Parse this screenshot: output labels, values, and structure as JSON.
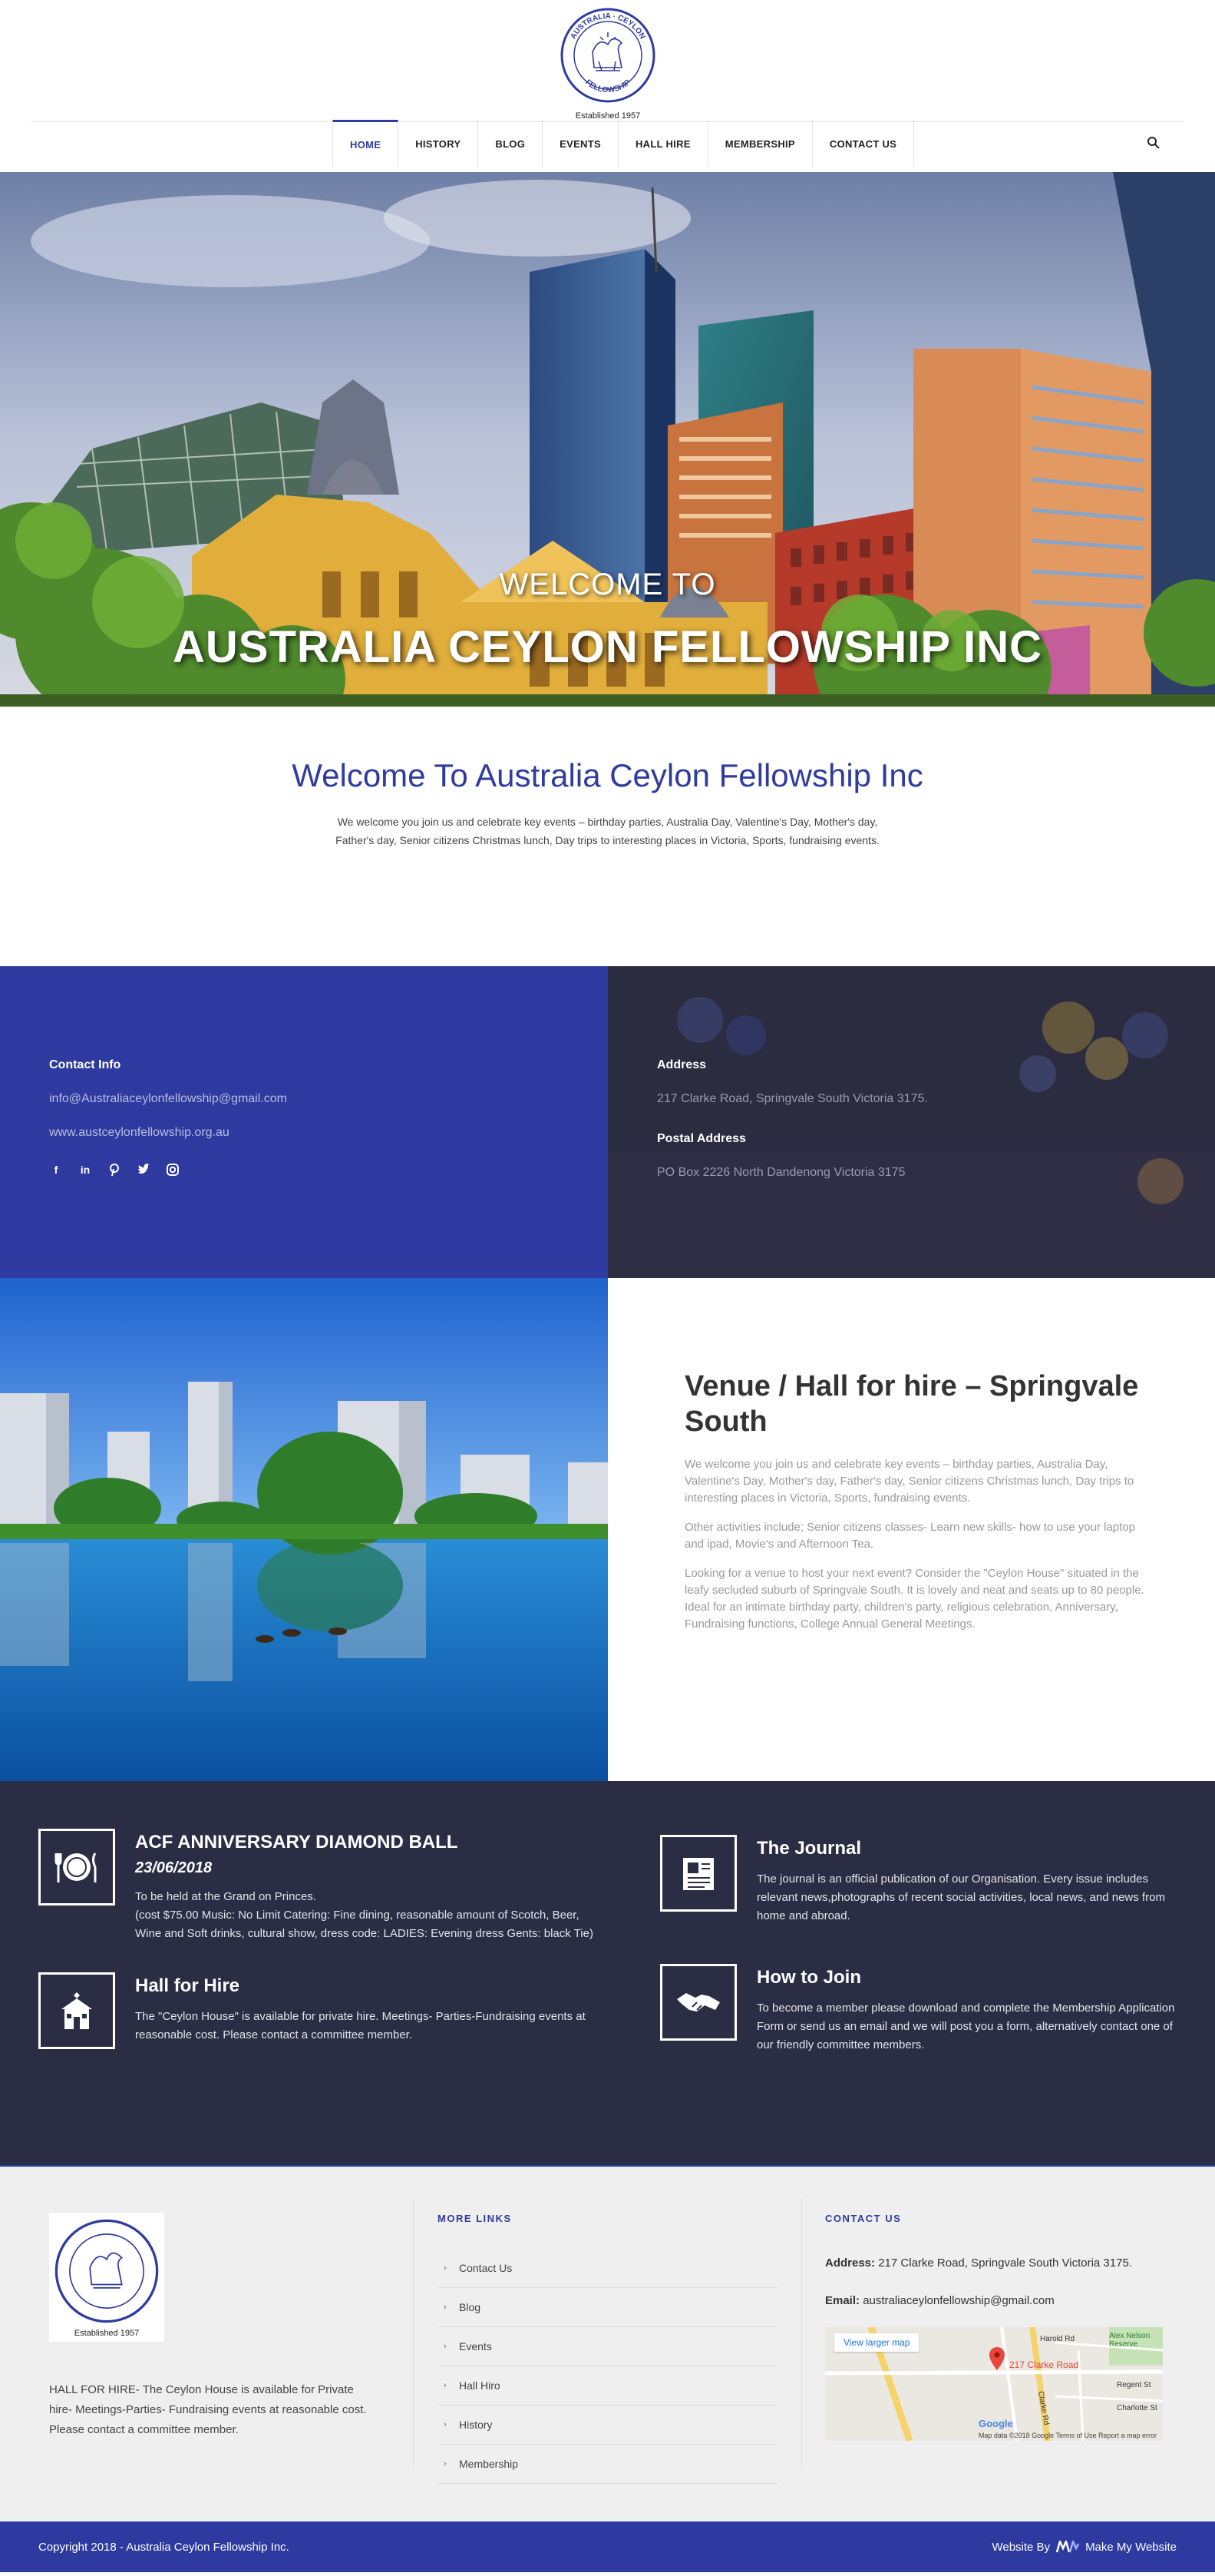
{
  "header": {
    "logo_ring_top": "AUSTRALIA · CEYLON",
    "logo_ring_bottom": "FELLOWSHIP",
    "logo_caption": "Established 1957",
    "nav": [
      {
        "label": "HOME",
        "active": true
      },
      {
        "label": "HISTORY"
      },
      {
        "label": "BLOG"
      },
      {
        "label": "EVENTS"
      },
      {
        "label": "HALL HIRE"
      },
      {
        "label": "MEMBERSHIP"
      },
      {
        "label": "CONTACT US"
      }
    ],
    "search_icon": "search-icon"
  },
  "hero": {
    "subtitle": "WELCOME TO",
    "title": "AUSTRALIA CEYLON FELLOWSHIP INC"
  },
  "welcome": {
    "heading": "Welcome To Australia Ceylon Fellowship Inc",
    "text": "We welcome you join us and celebrate key events – birthday parties, Australia Day, Valentine's Day, Mother's day, Father's day, Senior citizens Christmas lunch, Day trips to interesting places in Victoria, Sports, fundraising events."
  },
  "contact": {
    "info_heading": "Contact Info",
    "email": "info@Australiaceylonfellowship@gmail.com",
    "website": "www.austceylonfellowship.org.au",
    "socials": [
      "facebook-icon",
      "linkedin-icon",
      "pinterest-icon",
      "twitter-icon",
      "instagram-icon"
    ],
    "address_heading": "Address",
    "address": "217 Clarke Road, Springvale South Victoria 3175.",
    "postal_heading": "Postal Address",
    "postal": "PO Box 2226 North Dandenong Victoria 3175"
  },
  "venue": {
    "heading": "Venue / Hall for hire – Springvale South",
    "p1": "We welcome you join us and celebrate key events – birthday parties, Australia Day, Valentine's Day, Mother's day, Father's day, Senior citizens Christmas lunch, Day trips to interesting places in Victoria, Sports, fundraising events.",
    "p2": "Other activities include; Senior citizens classes- Learn new skills- how to use your laptop and ipad, Movie's and Afternoon Tea.",
    "p3": "Looking for a venue to host your next event? Consider the \"Ceylon House\" situated in the leafy secluded suburb of Springvale South. It is lovely and neat and seats up to 80 people. Ideal for an intimate birthday party, children's party, religious celebration, Anniversary, Fundraising functions, College Annual General Meetings."
  },
  "features": {
    "ball": {
      "title": "ACF ANNIVERSARY DIAMOND BALL",
      "date": "23/06/2018",
      "text": "To be held at the Grand on Princes.\n(cost $75.00 Music: No Limit Catering: Fine dining, reasonable amount of Scotch, Beer, Wine and Soft drinks, cultural show, dress code: LADIES: Evening dress Gents: black Tie)",
      "icon": "dining-plate-icon"
    },
    "hall": {
      "title": "Hall for Hire",
      "text": "The \"Ceylon House\" is available for private hire. Meetings- Parties-Fundraising events at reasonable cost. Please contact a committee member.",
      "icon": "hall-building-icon"
    },
    "journal": {
      "title": "The Journal",
      "text": "The journal is an official publication of our Organisation. Every issue includes relevant news,photographs of recent social activities, local news, and news from home and abroad.",
      "icon": "newspaper-icon"
    },
    "join": {
      "title": "How to Join",
      "text": "To become a member please download and complete the Membership Application Form or send us an email and we will post you a form, alternatively contact one of our friendly committee members.",
      "icon": "handshake-icon"
    }
  },
  "footer": {
    "logo_caption": "Established 1957",
    "about": "HALL FOR HIRE- The Ceylon House is available for Private hire- Meetings-Parties- Fundraising events at reasonable cost. Please contact a committee member.",
    "more_links_heading": "MORE LINKS",
    "links": [
      "Contact Us",
      "Blog",
      "Events",
      "Hall Hiro",
      "History",
      "Membership"
    ],
    "contact_heading": "CONTACT US",
    "address_label": "Address:",
    "address": "217 Clarke Road, Springvale South Victoria 3175.",
    "email_label": "Email:",
    "email": "australiaceylonfellowship@gmail.com",
    "map": {
      "button": "View larger map",
      "pin_label": "217 Clarke Road",
      "labels": [
        "Harold Rd",
        "Alex Nelson Reserve",
        "Clarke Rd",
        "Regent St",
        "Charlotte St"
      ],
      "brand": "Google",
      "footer": "Map data ©2018 Google   Terms of Use   Report a map error"
    }
  },
  "copyright": {
    "left": "Copyright 2018 - Australia Ceylon Fellowship Inc.",
    "right_prefix": "Website By",
    "right_brand": "Make My Website"
  }
}
